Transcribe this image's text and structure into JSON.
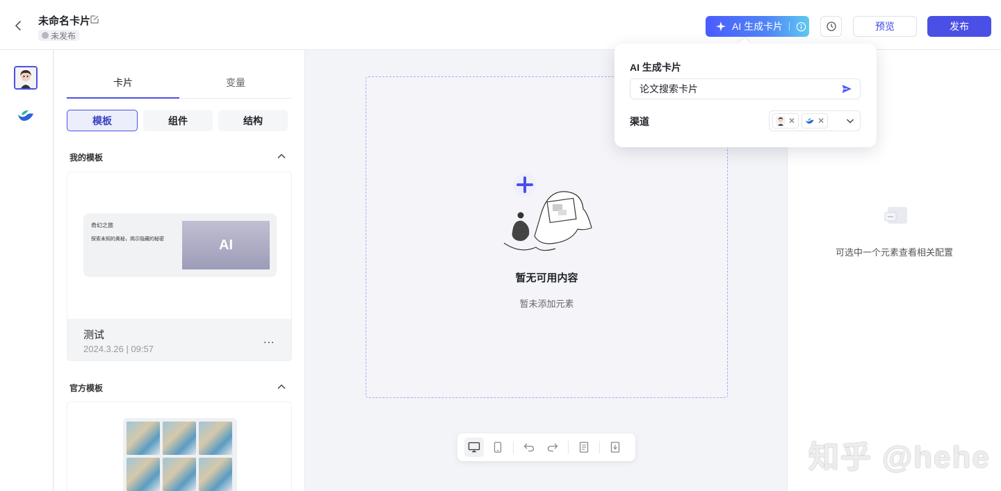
{
  "header": {
    "title": "未命名卡片",
    "status": "未发布",
    "ai_button_label": "AI 生成卡片",
    "preview_label": "预览",
    "publish_label": "发布"
  },
  "panel": {
    "tabs": [
      {
        "label": "卡片"
      },
      {
        "label": "变量"
      }
    ],
    "segments": [
      {
        "label": "模板"
      },
      {
        "label": "组件"
      },
      {
        "label": "结构"
      }
    ],
    "my_templates": {
      "heading": "我的模板",
      "card": {
        "thumb_title": "奇幻之旅",
        "thumb_desc": "探索未知的奥秘，揭示隐藏的秘密",
        "thumb_image_text": "AI",
        "name": "测试",
        "date": "2024.3.26 | 09:57",
        "more": "..."
      }
    },
    "official_templates": {
      "heading": "官方模板"
    }
  },
  "canvas": {
    "empty_title": "暂无可用内容",
    "empty_subtitle": "暂未添加元素"
  },
  "right_panel": {
    "hint": "可选中一个元素查看相关配置"
  },
  "popover": {
    "title": "AI 生成卡片",
    "input_value": "论文搜索卡片",
    "channel_label": "渠道"
  },
  "watermark": "知乎 @hehe",
  "colors": {
    "accent": "#4a4fe6",
    "accent_gradient_end": "#5fc9f0",
    "dropzone_border": "#a6abf0"
  },
  "icons": [
    "back-arrow-icon",
    "edit-icon",
    "clock-icon",
    "sparkle-icon",
    "info-icon",
    "history-icon",
    "chevron-up-icon",
    "more-icon",
    "plus-icon",
    "desktop-icon",
    "mobile-icon",
    "undo-icon",
    "redo-icon",
    "document-icon",
    "export-icon",
    "send-icon",
    "chevron-down-icon",
    "close-icon"
  ]
}
